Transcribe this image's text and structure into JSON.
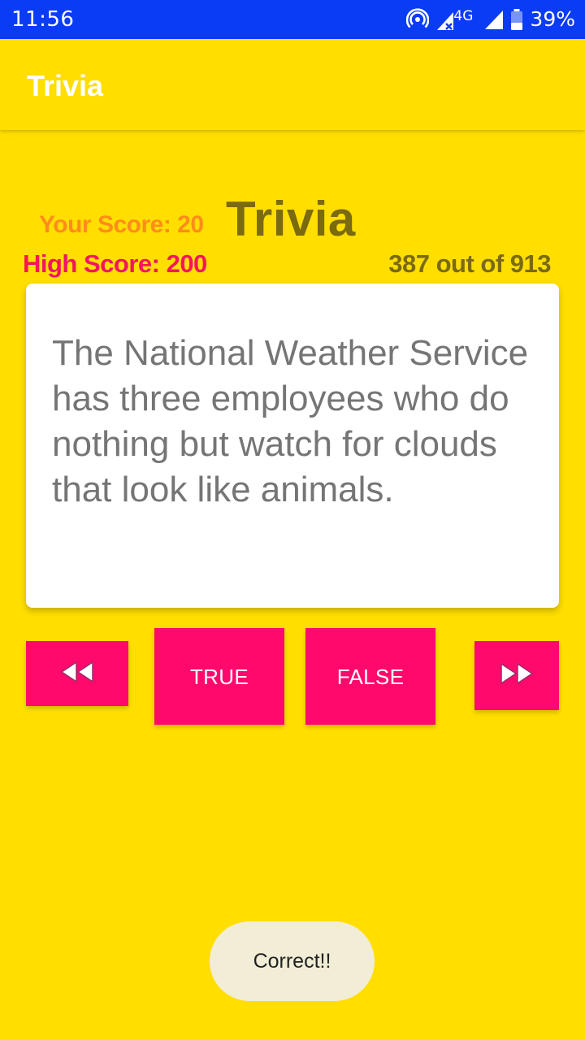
{
  "status_bar": {
    "time": "11:56",
    "network": "4G",
    "battery": "39%",
    "icons": [
      "hotspot-icon",
      "signal-no-data-icon",
      "signal-icon",
      "battery-icon"
    ]
  },
  "app_bar": {
    "title": "Trivia"
  },
  "scoreboard": {
    "your_score": "Your Score: 20",
    "high_score": "High Score: 200",
    "title": "Trivia",
    "progress": "387 out of 913"
  },
  "question": {
    "text": "The National Weather Service has three employees who do nothing but watch for clouds that look like animals."
  },
  "controls": {
    "prev_icon": "rewind-icon",
    "true_label": "TRUE",
    "false_label": "FALSE",
    "next_icon": "fast-forward-icon"
  },
  "toast": {
    "text": "Correct!!"
  },
  "colors": {
    "background": "#FFDE00",
    "status_bar": "#0A3CF5",
    "button": "#FF0A6C",
    "your_score": "#FF8C1A",
    "high_score": "#F5145F",
    "title": "#7A6A10",
    "question_text": "#757575",
    "toast_bg": "#F1EDD6"
  }
}
